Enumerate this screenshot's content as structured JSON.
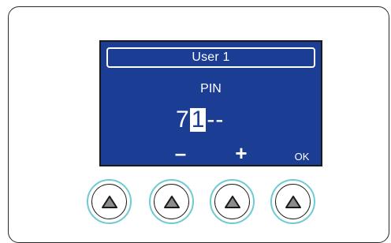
{
  "display": {
    "header": "User 1",
    "label": "PIN",
    "pin": {
      "first": "7",
      "cursor": "1",
      "rest": "--"
    },
    "softkeys": {
      "minus": "–",
      "plus": "+",
      "ok": "OK"
    }
  },
  "buttons": [
    {
      "icon": "triangle-up-icon"
    },
    {
      "icon": "triangle-up-icon"
    },
    {
      "icon": "triangle-up-icon"
    },
    {
      "icon": "triangle-up-icon"
    }
  ],
  "colors": {
    "lcd_background": "#1b3d94",
    "lcd_text": "#ffffff",
    "button_ring": "#6ecbd2",
    "button_icon": "#8c8c8c"
  }
}
